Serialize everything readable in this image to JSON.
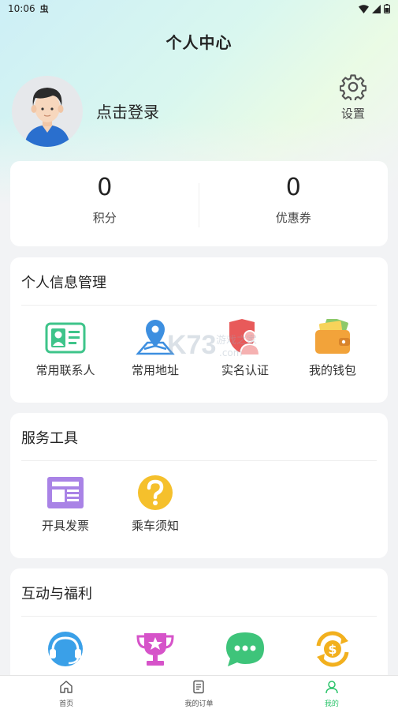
{
  "status_bar": {
    "time": "10:06",
    "carrier_glyph": "虫"
  },
  "header": {
    "title": "个人中心"
  },
  "profile": {
    "login_prompt": "点击登录",
    "settings_label": "设置"
  },
  "stats": [
    {
      "value": "0",
      "label": "积分"
    },
    {
      "value": "0",
      "label": "优惠券"
    }
  ],
  "sections": {
    "personal": {
      "title": "个人信息管理",
      "items": [
        {
          "label": "常用联系人",
          "icon": "contact-card-icon"
        },
        {
          "label": "常用地址",
          "icon": "location-pin-icon"
        },
        {
          "label": "实名认证",
          "icon": "verified-person-icon"
        },
        {
          "label": "我的钱包",
          "icon": "wallet-icon"
        }
      ]
    },
    "tools": {
      "title": "服务工具",
      "items": [
        {
          "label": "开具发票",
          "icon": "invoice-icon"
        },
        {
          "label": "乘车须知",
          "icon": "question-icon"
        }
      ]
    },
    "benefits": {
      "title": "互动与福利",
      "items": [
        {
          "icon": "customer-service-icon"
        },
        {
          "icon": "trophy-icon"
        },
        {
          "icon": "chat-bubble-icon"
        },
        {
          "icon": "currency-exchange-icon"
        }
      ]
    }
  },
  "tabbar": [
    {
      "label": "首页",
      "icon": "home-icon"
    },
    {
      "label": "我的订单",
      "icon": "order-list-icon"
    },
    {
      "label": "我的",
      "icon": "person-icon",
      "active": true
    }
  ],
  "watermark": {
    "text": "K73",
    "subtext": "游戏之家",
    "domain": ".com"
  },
  "colors": {
    "accent": "#2cc46b",
    "background": "#f2f3f5"
  }
}
